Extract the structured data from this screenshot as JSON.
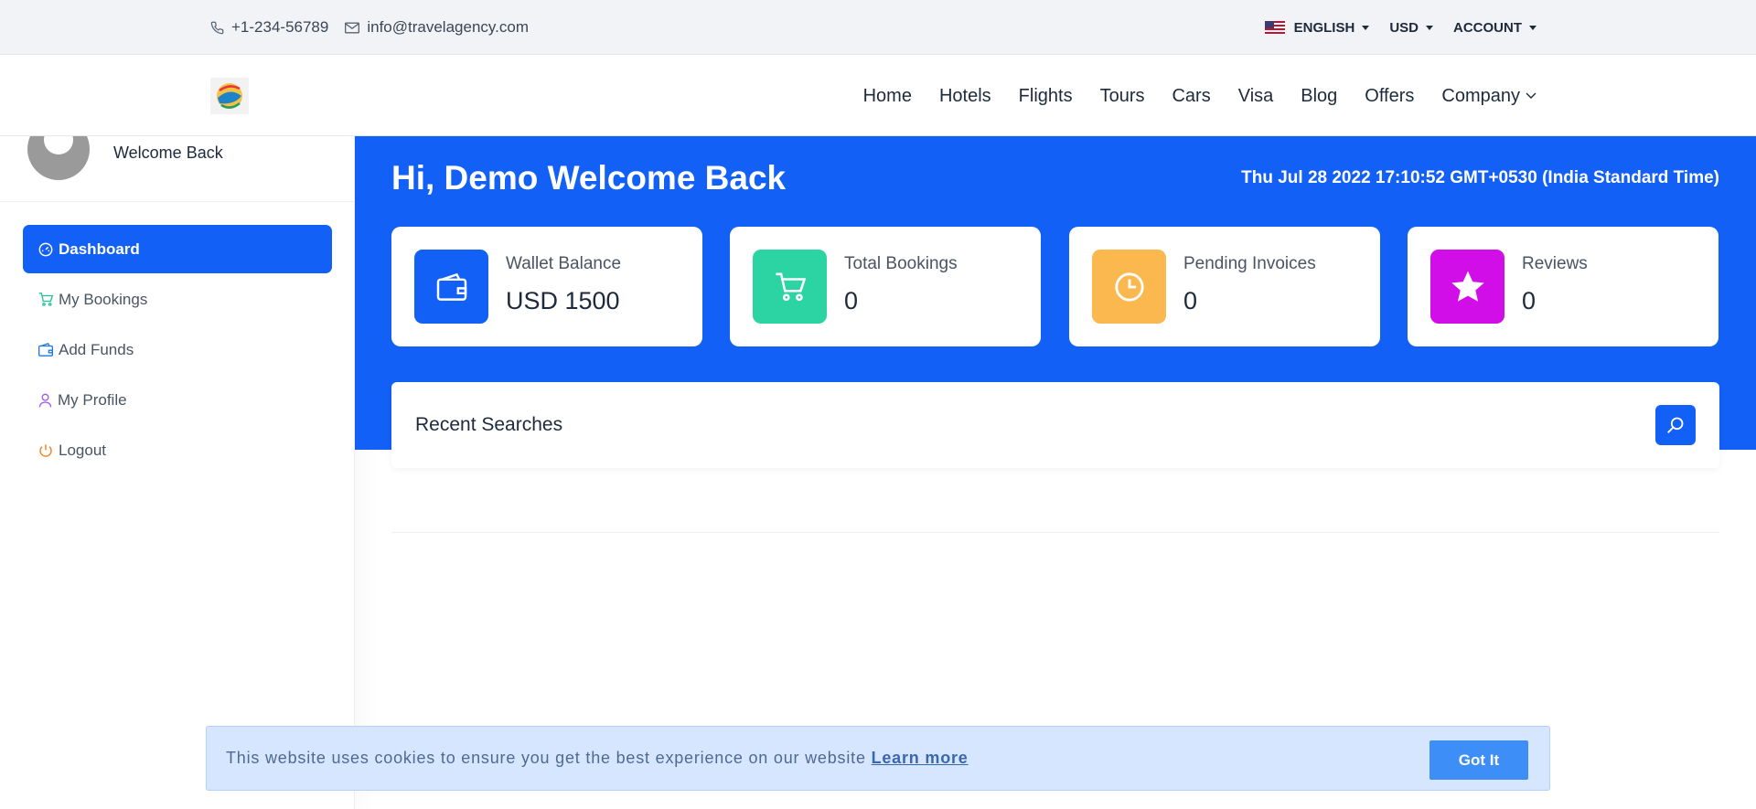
{
  "topbar": {
    "phone": "+1-234-56789",
    "email": "info@travelagency.com",
    "language": "ENGLISH",
    "currency": "USD",
    "account": "ACCOUNT"
  },
  "nav": {
    "items": [
      "Home",
      "Hotels",
      "Flights",
      "Tours",
      "Cars",
      "Visa",
      "Blog",
      "Offers",
      "Company"
    ]
  },
  "sidebar": {
    "welcome": "Welcome Back",
    "items": [
      {
        "label": "Dashboard",
        "icon": "speedometer-icon",
        "active": true
      },
      {
        "label": "My Bookings",
        "icon": "cart-icon",
        "color": "#22c39a"
      },
      {
        "label": "Add Funds",
        "icon": "wallet-icon",
        "color": "#1f7ad8"
      },
      {
        "label": "My Profile",
        "icon": "user-icon",
        "color": "#9b59f5"
      },
      {
        "label": "Logout",
        "icon": "power-icon",
        "color": "#f5841f"
      }
    ]
  },
  "hero": {
    "title": "Hi, Demo Welcome Back",
    "datetime": "Thu Jul 28 2022 17:10:52 GMT+0530 (India Standard Time)"
  },
  "cards": [
    {
      "label": "Wallet Balance",
      "value": "USD 1500",
      "icon": "wallet-icon",
      "color": "#1260f6"
    },
    {
      "label": "Total Bookings",
      "value": "0",
      "icon": "cart-icon",
      "color": "#2bd4a2"
    },
    {
      "label": "Pending Invoices",
      "value": "0",
      "icon": "clock-icon",
      "color": "#fbb84e"
    },
    {
      "label": "Reviews",
      "value": "0",
      "icon": "star-icon",
      "color": "#d10ee8"
    }
  ],
  "recent": {
    "title": "Recent Searches"
  },
  "cookie": {
    "text": "This website uses cookies to ensure you get the best experience on our website",
    "link": "Learn more",
    "button": "Got It"
  },
  "colors": {
    "primary": "#1260f6",
    "topbar_bg": "#f1f3f6",
    "cookie_bg": "#d7e6ff"
  }
}
